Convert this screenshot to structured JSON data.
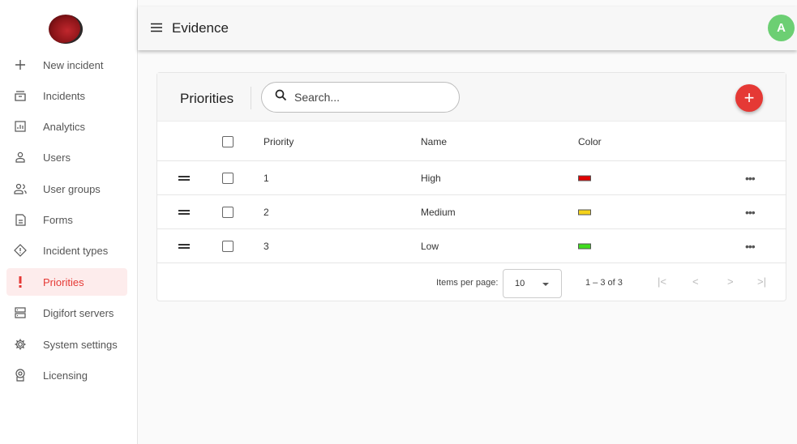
{
  "sidebar": {
    "items": [
      {
        "label": "New incident",
        "icon": "plus-icon"
      },
      {
        "label": "Incidents",
        "icon": "incidents-icon"
      },
      {
        "label": "Analytics",
        "icon": "analytics-icon"
      },
      {
        "label": "Users",
        "icon": "user-icon"
      },
      {
        "label": "User groups",
        "icon": "user-groups-icon"
      },
      {
        "label": "Forms",
        "icon": "form-icon"
      },
      {
        "label": "Incident types",
        "icon": "incident-types-icon"
      },
      {
        "label": "Priorities",
        "icon": "exclamation-icon",
        "active": true
      },
      {
        "label": "Digifort servers",
        "icon": "server-icon"
      },
      {
        "label": "System settings",
        "icon": "gear-icon"
      },
      {
        "label": "Licensing",
        "icon": "license-icon"
      }
    ]
  },
  "header": {
    "title": "Evidence",
    "avatar_initial": "A",
    "avatar_color": "#6ccf73"
  },
  "card": {
    "title": "Priorities",
    "search_placeholder": "Search...",
    "add_label": "+",
    "columns": [
      "Priority",
      "Name",
      "Color"
    ],
    "rows": [
      {
        "priority": "1",
        "name": "High",
        "color": "#e00000"
      },
      {
        "priority": "2",
        "name": "Medium",
        "color": "#f4d21a"
      },
      {
        "priority": "3",
        "name": "Low",
        "color": "#3fdc1e"
      }
    ],
    "more_label": "•••"
  },
  "pager": {
    "items_per_page_label": "Items per page:",
    "page_size": "10",
    "range": "1 – 3 of 3",
    "first": "|<",
    "prev": "<",
    "next": ">",
    "last": ">|"
  },
  "colors": {
    "accent": "#e53935",
    "active_bg": "#fdecec"
  }
}
